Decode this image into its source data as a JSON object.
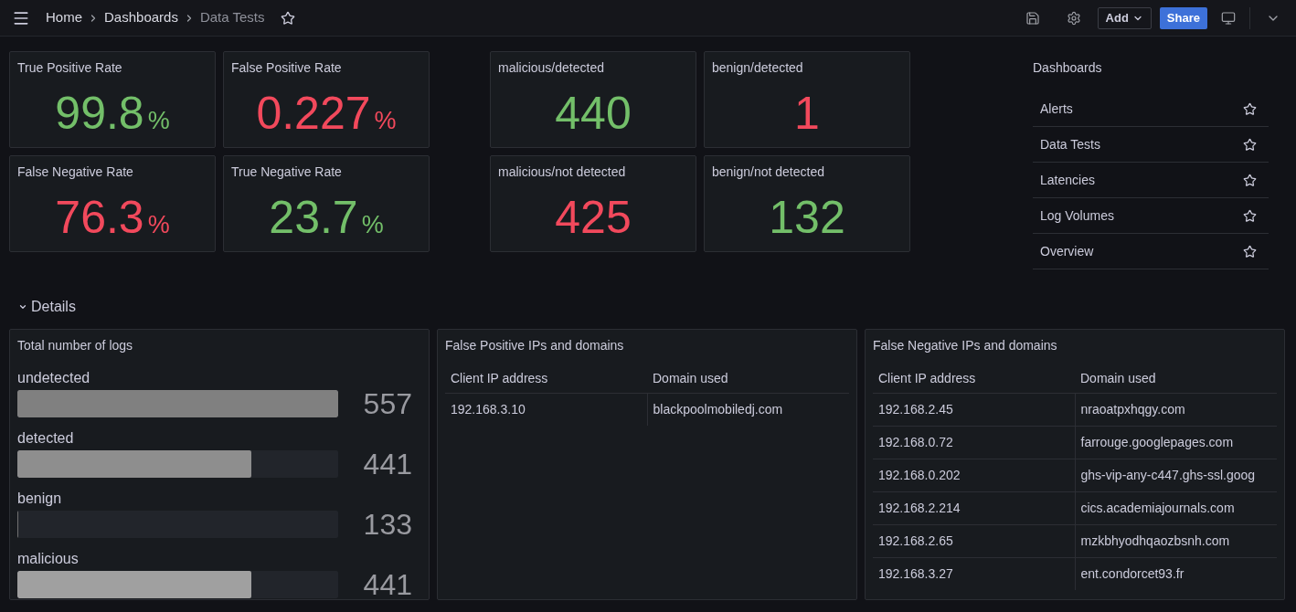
{
  "top_bar": {
    "breadcrumbs": [
      {
        "label": "Home",
        "current": false
      },
      {
        "label": "Dashboards",
        "current": false
      },
      {
        "label": "Data Tests",
        "current": true
      }
    ],
    "starred": false,
    "buttons": [
      {
        "label": "Add",
        "kind": "dropdown"
      },
      {
        "label": "Share",
        "kind": "primary"
      }
    ]
  },
  "rate_stats": [
    {
      "title": "True Positive Rate",
      "value": "99.8",
      "unit": "%",
      "color": "#73bf69"
    },
    {
      "title": "False Positive Rate",
      "value": "0.227",
      "unit": "%",
      "color": "#f2495c"
    },
    {
      "title": "False Negative Rate",
      "value": "76.3",
      "unit": "%",
      "color": "#f2495c"
    },
    {
      "title": "True Negative Rate",
      "value": "23.7",
      "unit": "%",
      "color": "#73bf69"
    }
  ],
  "count_stats": [
    {
      "title": "malicious/detected",
      "value": "440",
      "color": "#73bf69"
    },
    {
      "title": "benign/detected",
      "value": "1",
      "color": "#f2495c"
    },
    {
      "title": "malicious/not detected",
      "value": "425",
      "color": "#f2495c"
    },
    {
      "title": "benign/not detected",
      "value": "132",
      "color": "#73bf69"
    }
  ],
  "dashboards_list": {
    "title": "Dashboards",
    "items": [
      {
        "label": "Alerts",
        "starred": false
      },
      {
        "label": "Data Tests",
        "starred": false
      },
      {
        "label": "Latencies",
        "starred": false
      },
      {
        "label": "Log Volumes",
        "starred": false
      },
      {
        "label": "Overview",
        "starred": false
      }
    ]
  },
  "details_row": {
    "title": "Details",
    "expanded": true
  },
  "bar_gauge": {
    "title": "Total number of logs",
    "rows": [
      {
        "label": "undetected",
        "value": "557",
        "level": 1,
        "color": "#808080"
      },
      {
        "label": "detected",
        "value": "441",
        "level": 0.73,
        "color": "#8e8e8e"
      },
      {
        "label": "benign",
        "value": "133",
        "level": 0,
        "color": "#707070"
      },
      {
        "label": "malicious",
        "value": "441",
        "level": 0.73,
        "color": "#a0a0a0"
      }
    ]
  },
  "tables": [
    {
      "title": "False Positive IPs and domains",
      "columns": [
        "Client IP address",
        "Domain used"
      ],
      "rows": [
        [
          "192.168.3.10",
          "blackpoolmobiledj.com"
        ]
      ]
    },
    {
      "title": "False Negative IPs and domains",
      "columns": [
        "Client IP address",
        "Domain used"
      ],
      "rows": [
        [
          "192.168.2.45",
          "nraoatpxhqgy.com"
        ],
        [
          "192.168.0.72",
          "farrouge.googlepages.com"
        ],
        [
          "192.168.0.202",
          "ghs-vip-any-c447.ghs-ssl.goog"
        ],
        [
          "192.168.2.214",
          "cics.academiajournals.com"
        ],
        [
          "192.168.2.65",
          "mzkbhyodhqaozbsnh.com"
        ],
        [
          "192.168.3.27",
          "ent.condorcet93.fr"
        ]
      ]
    }
  ]
}
